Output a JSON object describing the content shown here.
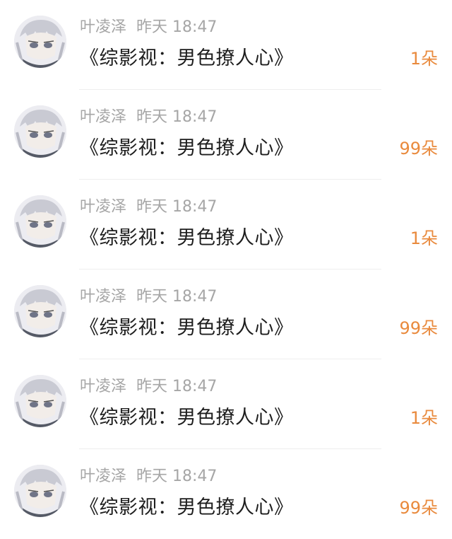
{
  "accent_color": "#e98a3d",
  "items": [
    {
      "name": "叶凌泽",
      "time": "昨天 18:47",
      "title": "《综影视：男色撩人心》",
      "count": "1朵",
      "avatar_icon": "anime-avatar"
    },
    {
      "name": "叶凌泽",
      "time": "昨天 18:47",
      "title": "《综影视：男色撩人心》",
      "count": "99朵",
      "avatar_icon": "anime-avatar"
    },
    {
      "name": "叶凌泽",
      "time": "昨天 18:47",
      "title": "《综影视：男色撩人心》",
      "count": "1朵",
      "avatar_icon": "anime-avatar"
    },
    {
      "name": "叶凌泽",
      "time": "昨天 18:47",
      "title": "《综影视：男色撩人心》",
      "count": "99朵",
      "avatar_icon": "anime-avatar"
    },
    {
      "name": "叶凌泽",
      "time": "昨天 18:47",
      "title": "《综影视：男色撩人心》",
      "count": "1朵",
      "avatar_icon": "anime-avatar"
    },
    {
      "name": "叶凌泽",
      "time": "昨天 18:47",
      "title": "《综影视：男色撩人心》",
      "count": "99朵",
      "avatar_icon": "anime-avatar"
    }
  ]
}
